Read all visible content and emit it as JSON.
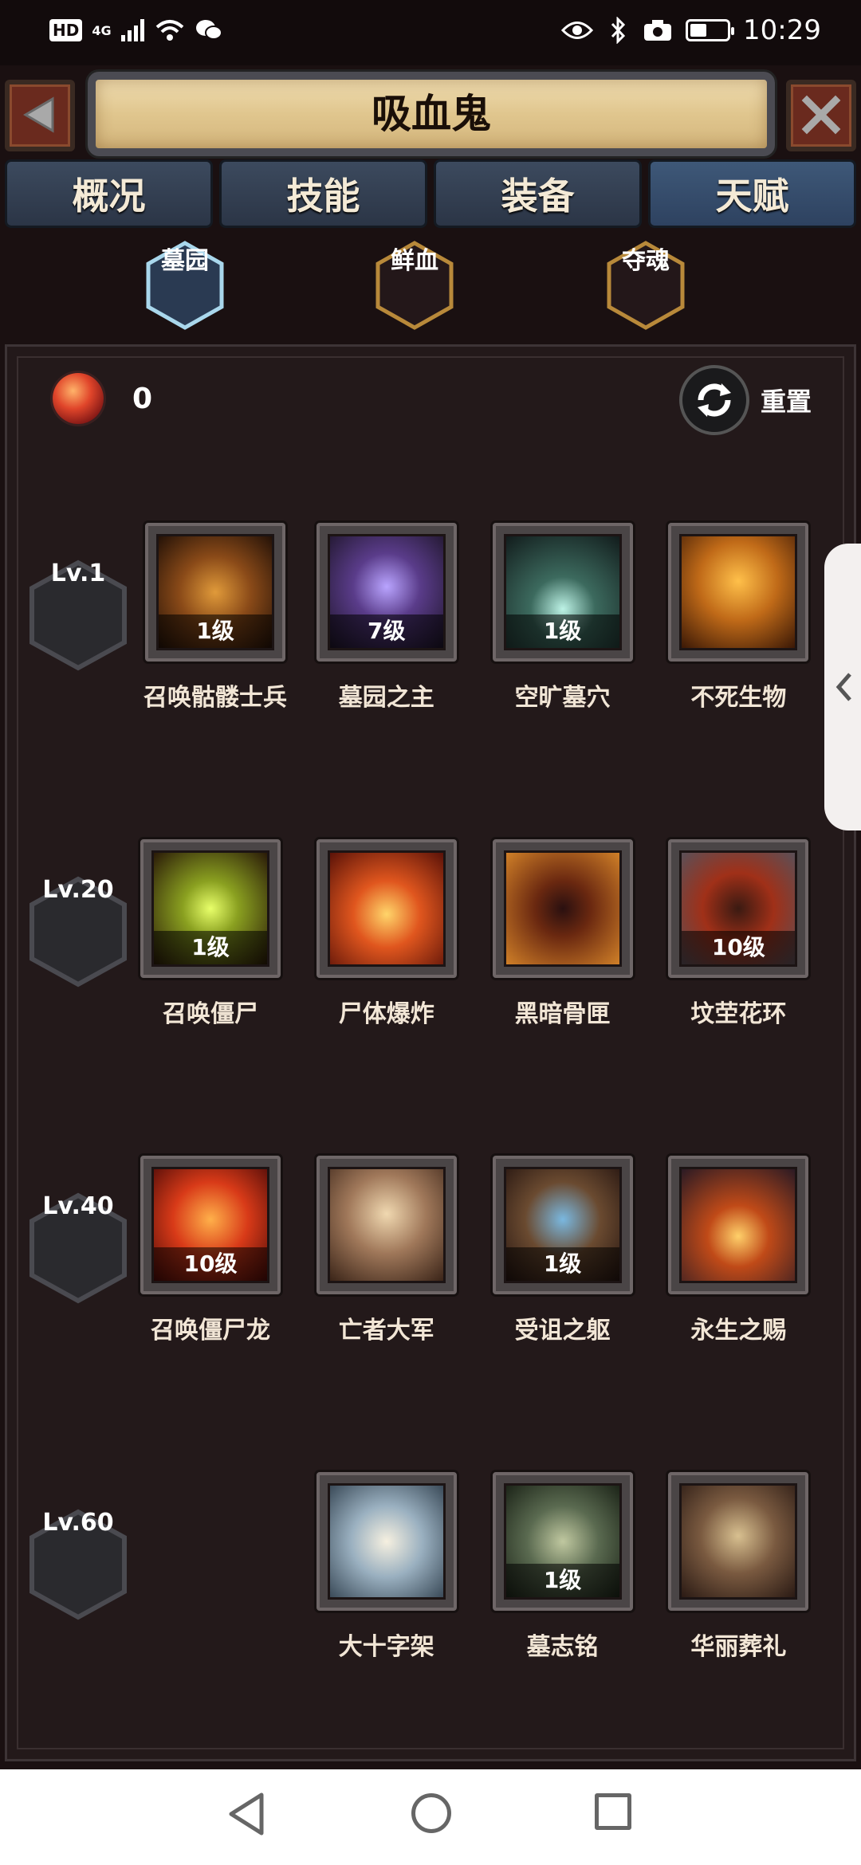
{
  "status_bar": {
    "hd": "HD",
    "network": "4G",
    "time": "10:29",
    "battery_percent": 45
  },
  "header": {
    "title": "吸血鬼"
  },
  "tabs": [
    {
      "label": "概况",
      "active": false
    },
    {
      "label": "技能",
      "active": false
    },
    {
      "label": "装备",
      "active": false
    },
    {
      "label": "天赋",
      "active": true
    }
  ],
  "subtabs": [
    {
      "label": "墓园",
      "active": true
    },
    {
      "label": "鲜血",
      "active": false
    },
    {
      "label": "夺魂",
      "active": false
    }
  ],
  "talent_points": {
    "value": "0"
  },
  "reset": {
    "label": "重置"
  },
  "tiers": [
    {
      "level": "Lv.1",
      "talents": [
        {
          "name": "召唤骷髅士兵",
          "level": "1级",
          "icon": "skeleton-soldier-icon"
        },
        {
          "name": "墓园之主",
          "level": "7级",
          "icon": "graveyard-lord-icon"
        },
        {
          "name": "空旷墓穴",
          "level": "1级",
          "icon": "empty-tomb-icon"
        },
        {
          "name": "不死生物",
          "level": "",
          "icon": "undead-creature-icon"
        }
      ]
    },
    {
      "level": "Lv.20",
      "talents": [
        {
          "name": "召唤僵尸",
          "level": "1级",
          "icon": "summon-zombie-icon"
        },
        {
          "name": "尸体爆炸",
          "level": "",
          "icon": "corpse-explosion-icon"
        },
        {
          "name": "黑暗骨匣",
          "level": "",
          "icon": "dark-bone-box-icon"
        },
        {
          "name": "坟茔花环",
          "level": "10级",
          "icon": "grave-wreath-icon"
        }
      ]
    },
    {
      "level": "Lv.40",
      "talents": [
        {
          "name": "召唤僵尸龙",
          "level": "10级",
          "icon": "zombie-dragon-icon"
        },
        {
          "name": "亡者大军",
          "level": "",
          "icon": "army-of-dead-icon"
        },
        {
          "name": "受诅之躯",
          "level": "1级",
          "icon": "cursed-body-icon"
        },
        {
          "name": "永生之赐",
          "level": "",
          "icon": "immortal-gift-icon"
        }
      ]
    },
    {
      "level": "Lv.60",
      "talents": [
        {
          "name": "大十字架",
          "level": "",
          "icon": "great-cross-icon"
        },
        {
          "name": "墓志铭",
          "level": "1级",
          "icon": "epitaph-icon"
        },
        {
          "name": "华丽葬礼",
          "level": "",
          "icon": "grand-funeral-icon"
        }
      ]
    }
  ],
  "colors": {
    "background": "#1a1011",
    "tab_active": "#2e4260",
    "tab_inactive": "#2b3546",
    "title_parchment": "#e0c68e",
    "subtab_active_border": "#9fd0e8",
    "subtab_border": "#b8893a"
  }
}
